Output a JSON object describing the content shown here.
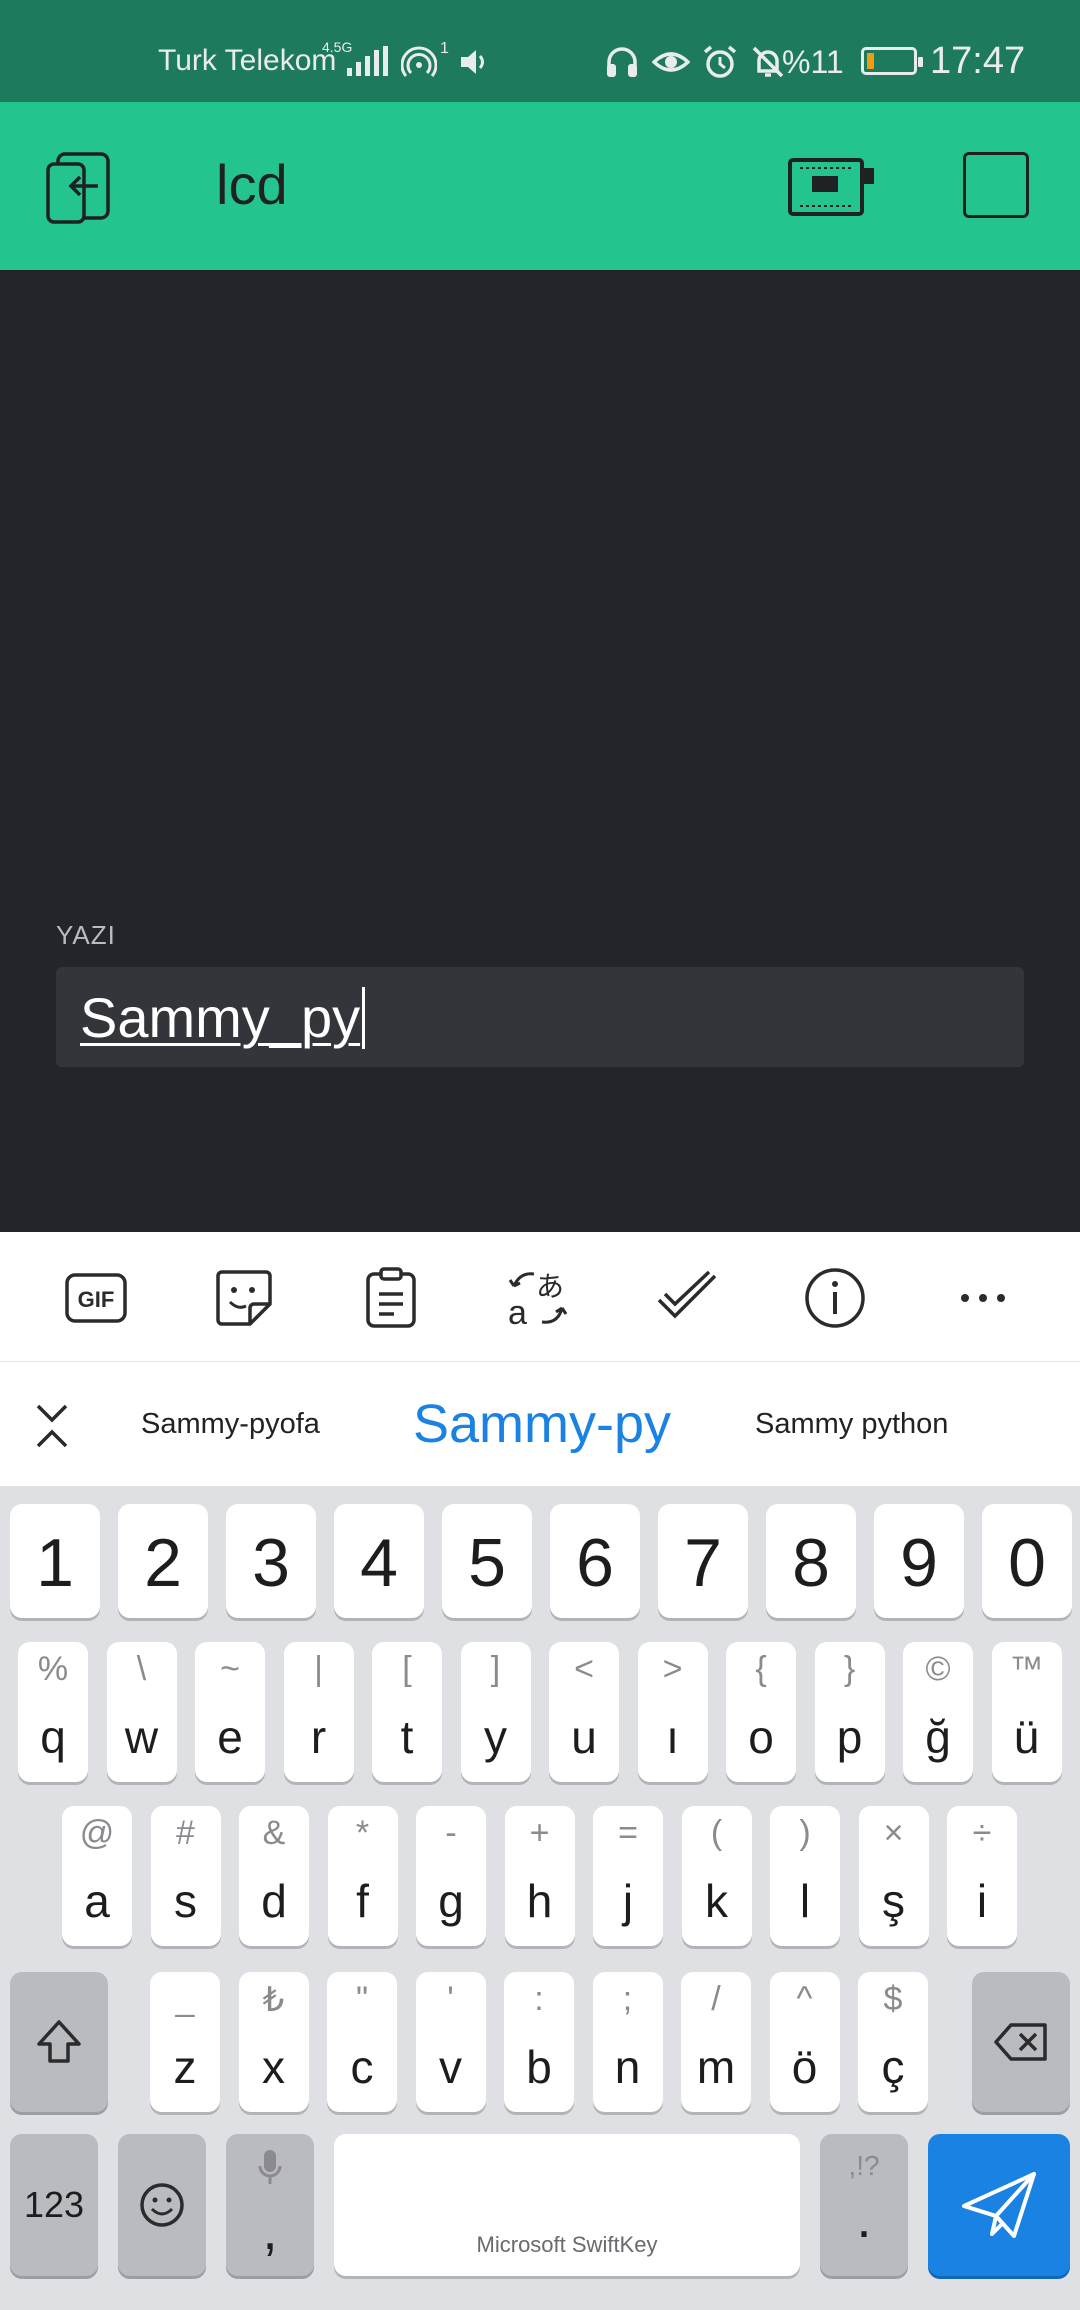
{
  "status_bar": {
    "carrier": "Turk Telekom",
    "network_type": "4.5G",
    "hotspot_count": "1",
    "battery_percent": "%11",
    "time": "17:47",
    "icons": [
      "signal-icon",
      "hotspot-icon",
      "volume-icon",
      "headphones-icon",
      "eye-icon",
      "alarm-icon",
      "notifications-off-icon",
      "battery-icon"
    ]
  },
  "app_header": {
    "title": "lcd",
    "icons": [
      "exit-icon",
      "device-icon",
      "stop-icon"
    ]
  },
  "content": {
    "field_label": "YAZI",
    "field_value": "Sammy_py"
  },
  "keyboard_toolbar": {
    "icons": [
      "gif-icon",
      "sticker-icon",
      "clipboard-icon",
      "translate-icon",
      "checkmark-icon",
      "info-icon",
      "more-icon"
    ],
    "gif_label": "GIF"
  },
  "suggestions": {
    "items": [
      "Sammy-pyofa",
      "Sammy-py",
      "Sammy python"
    ]
  },
  "keyboard": {
    "numbers": [
      "1",
      "2",
      "3",
      "4",
      "5",
      "6",
      "7",
      "8",
      "9",
      "0"
    ],
    "row1": [
      {
        "main": "q",
        "alt": "%"
      },
      {
        "main": "w",
        "alt": "\\"
      },
      {
        "main": "e",
        "alt": "~"
      },
      {
        "main": "r",
        "alt": "|"
      },
      {
        "main": "t",
        "alt": "["
      },
      {
        "main": "y",
        "alt": "]"
      },
      {
        "main": "u",
        "alt": "<"
      },
      {
        "main": "ı",
        "alt": ">"
      },
      {
        "main": "o",
        "alt": "{"
      },
      {
        "main": "p",
        "alt": "}"
      },
      {
        "main": "ğ",
        "alt": "©"
      },
      {
        "main": "ü",
        "alt": "™"
      }
    ],
    "row2": [
      {
        "main": "a",
        "alt": "@"
      },
      {
        "main": "s",
        "alt": "#"
      },
      {
        "main": "d",
        "alt": "&"
      },
      {
        "main": "f",
        "alt": "*"
      },
      {
        "main": "g",
        "alt": "-"
      },
      {
        "main": "h",
        "alt": "+"
      },
      {
        "main": "j",
        "alt": "="
      },
      {
        "main": "k",
        "alt": "("
      },
      {
        "main": "l",
        "alt": ")"
      },
      {
        "main": "ş",
        "alt": "×"
      },
      {
        "main": "i",
        "alt": "÷"
      }
    ],
    "row3": [
      {
        "main": "z",
        "alt": "_"
      },
      {
        "main": "x",
        "alt": "₺"
      },
      {
        "main": "c",
        "alt": "\""
      },
      {
        "main": "v",
        "alt": "'"
      },
      {
        "main": "b",
        "alt": ":"
      },
      {
        "main": "n",
        "alt": ";"
      },
      {
        "main": "m",
        "alt": "/"
      },
      {
        "main": "ö",
        "alt": "^"
      },
      {
        "main": "ç",
        "alt": "$"
      }
    ],
    "numeric_toggle": "123",
    "comma": ",",
    "period": ".",
    "period_alt": ",!?",
    "space_label": "Microsoft SwiftKey"
  },
  "colors": {
    "status_bar": "#1e7a5c",
    "header": "#23c48e",
    "background": "#23252b",
    "accent": "#1a82e2"
  }
}
